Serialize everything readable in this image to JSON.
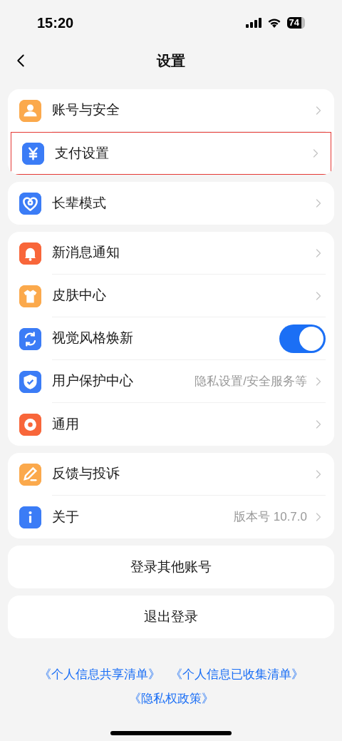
{
  "status_bar": {
    "time": "15:20",
    "battery": "74"
  },
  "header": {
    "title": "设置"
  },
  "groups": [
    {
      "items": [
        {
          "kind": "link",
          "color": "#fba94c",
          "label": "账号与安全",
          "highlighted": false
        },
        {
          "kind": "link",
          "color": "#3b7cf6",
          "label": "支付设置",
          "highlighted": true
        }
      ]
    },
    {
      "items": [
        {
          "kind": "link",
          "color": "#3b7cf6",
          "label": "长辈模式",
          "highlighted": false
        }
      ]
    },
    {
      "items": [
        {
          "kind": "link",
          "color": "#f8663a",
          "label": "新消息通知",
          "highlighted": false
        },
        {
          "kind": "link",
          "color": "#fba94c",
          "label": "皮肤中心",
          "highlighted": false
        },
        {
          "kind": "toggle",
          "color": "#3b7cf6",
          "label": "视觉风格焕新",
          "on": true,
          "highlighted": false
        },
        {
          "kind": "link",
          "color": "#3b7cf6",
          "label": "用户保护中心",
          "value": "隐私设置/安全服务等",
          "highlighted": false
        },
        {
          "kind": "link",
          "color": "#f8663a",
          "label": "通用",
          "highlighted": false
        }
      ]
    },
    {
      "items": [
        {
          "kind": "link",
          "color": "#fba94c",
          "label": "反馈与投诉",
          "highlighted": false
        },
        {
          "kind": "link",
          "color": "#3b7cf6",
          "label": "关于",
          "value": "版本号 10.7.0",
          "highlighted": false
        }
      ]
    }
  ],
  "buttons": [
    "登录其他账号",
    "退出登录"
  ],
  "links": [
    [
      "《个人信息共享清单》",
      "《个人信息已收集清单》"
    ],
    [
      "《隐私权政策》"
    ]
  ]
}
